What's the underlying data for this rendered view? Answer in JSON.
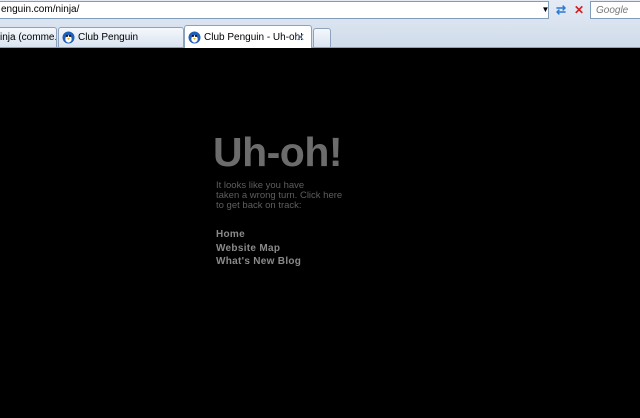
{
  "browser": {
    "url": "enguin.com/ninja/",
    "search_placeholder": "Google",
    "tabs": [
      {
        "label": "inja (comme..."
      },
      {
        "label": "Club Penguin"
      },
      {
        "label": "Club Penguin - Uh-oh!"
      }
    ]
  },
  "page": {
    "headline": "Uh-oh!",
    "message_lines": [
      "It looks like you have",
      "taken a wrong turn. Click here",
      "to get back on track:"
    ],
    "links": [
      "Home",
      "Website Map",
      "What's New Blog"
    ]
  },
  "colors": {
    "background": "#000000",
    "headline": "#6c6c6c",
    "message": "#5e5e5e",
    "links": "#8a8a8a"
  }
}
